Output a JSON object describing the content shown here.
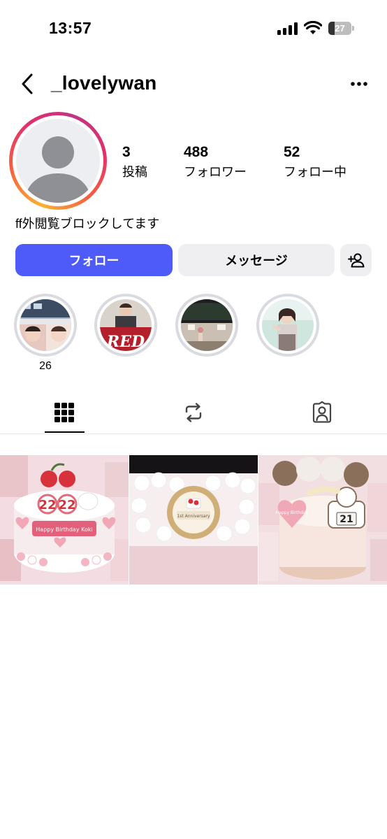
{
  "status_bar": {
    "time": "13:57",
    "battery": "27"
  },
  "header": {
    "username": "_lovelywan"
  },
  "stats": [
    {
      "value": "3",
      "label": "投稿"
    },
    {
      "value": "488",
      "label": "フォロワー"
    },
    {
      "value": "52",
      "label": "フォロー中"
    }
  ],
  "bio": "ff外閲覧ブロックしてます",
  "buttons": {
    "follow": "フォロー",
    "message": "メッセージ"
  },
  "highlights": [
    {
      "label": "26"
    },
    {
      "label": ""
    },
    {
      "label": ""
    },
    {
      "label": ""
    }
  ],
  "highlight_images": {
    "h2_caption": "RED"
  },
  "posts": [
    {
      "caption": "Happy Birthday Koki",
      "number": "22"
    },
    {
      "caption": "1st Anniversary"
    },
    {
      "caption": "Happy Birthday",
      "number": "21"
    }
  ],
  "icons": {
    "back": "chevron-left-icon",
    "more": "more-horizontal-icon",
    "add_user": "add-user-icon",
    "grid": "grid-icon",
    "reels": "repost-icon",
    "tagged": "tagged-person-icon",
    "default_avatar": "default-avatar-icon"
  },
  "colors": {
    "follow_button": "#4f5bf8",
    "secondary_button": "#efeff1",
    "story_ring": "#e1306c"
  }
}
